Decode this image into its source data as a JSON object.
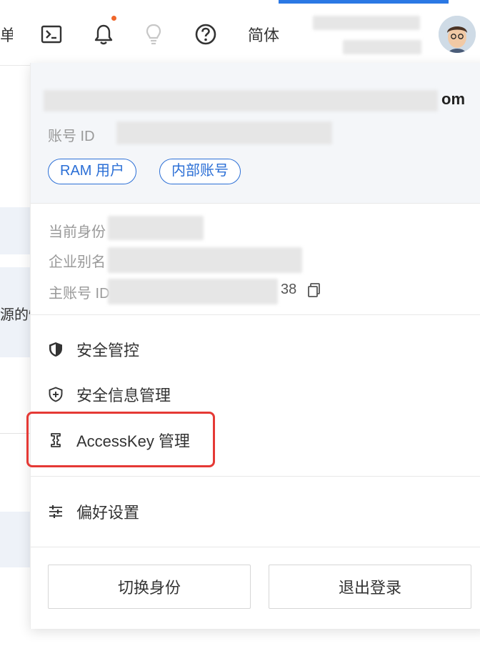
{
  "topbar": {
    "menu_partial": "单",
    "lang_label": "简体",
    "icons": [
      "terminal-icon",
      "bell-icon",
      "lightbulb-icon",
      "help-icon"
    ],
    "notification_color": "#f0662a",
    "accent_color": "#2b78e4"
  },
  "background": {
    "left_text": "源的性"
  },
  "panel": {
    "account_suffix": "om",
    "account_id_label": "账号 ID",
    "tags": [
      "RAM 用户",
      "内部账号"
    ],
    "current_identity_label": "当前身份",
    "enterprise_alias_label": "企业别名",
    "main_account_label": "主账号 ID",
    "main_account_suffix": "38",
    "menu": [
      {
        "label": "安全管控",
        "icon": "shield-filled-icon"
      },
      {
        "label": "安全信息管理",
        "icon": "shield-plus-icon"
      },
      {
        "label": "AccessKey 管理",
        "icon": "key-icon"
      },
      {
        "label": "偏好设置",
        "icon": "sliders-icon"
      }
    ],
    "buttons": {
      "switch_identity": "切换身份",
      "logout": "退出登录"
    },
    "highlight_color": "#e53935",
    "tag_color": "#2b6fd6"
  }
}
